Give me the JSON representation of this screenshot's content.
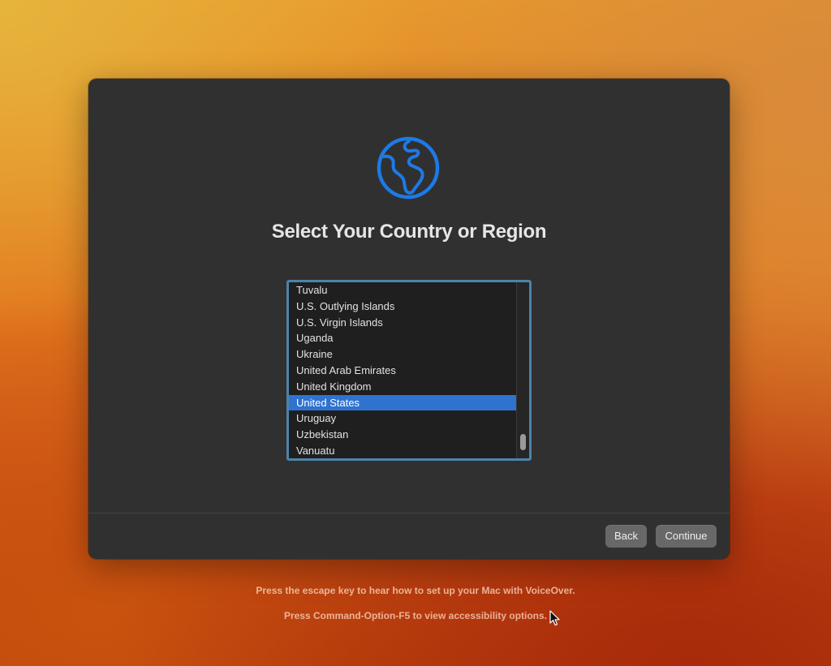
{
  "dialog": {
    "title": "Select Your Country or Region",
    "icon": "globe-icon",
    "accent_color": "#1d7ae6"
  },
  "country_list": {
    "items": [
      "Tuvalu",
      "U.S. Outlying Islands",
      "U.S. Virgin Islands",
      "Uganda",
      "Ukraine",
      "United Arab Emirates",
      "United Kingdom",
      "United States",
      "Uruguay",
      "Uzbekistan",
      "Vanuatu"
    ],
    "selected": "United States",
    "selection_color": "#2f73cf"
  },
  "buttons": {
    "back_label": "Back",
    "continue_label": "Continue"
  },
  "hints": {
    "voiceover": "Press the escape key to hear how to set up your Mac with VoiceOver.",
    "accessibility": "Press Command-Option-F5 to view accessibility options."
  }
}
